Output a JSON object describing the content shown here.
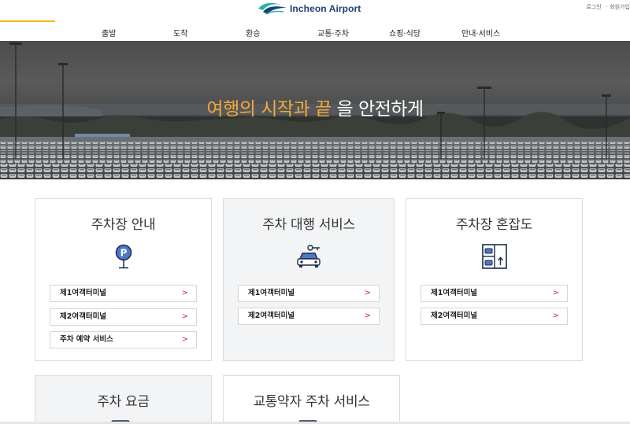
{
  "header": {
    "logo_text": "Incheon Airport",
    "util": {
      "login": "로그인",
      "join": "· 회원가입"
    },
    "nav": [
      {
        "label": "출발"
      },
      {
        "label": "도착"
      },
      {
        "label": "환승"
      },
      {
        "label": "교통·주차"
      },
      {
        "label": "쇼핑·식당"
      },
      {
        "label": "안내·서비스"
      }
    ]
  },
  "hero": {
    "title_highlight": "여행의 시작과 끝",
    "title_rest": " 을 안전하게"
  },
  "cards": {
    "parking_info": {
      "title": "주차장 안내",
      "links": [
        "제1여객터미널",
        "제2여객터미널",
        "주차 예약 서비스"
      ]
    },
    "valet": {
      "title": "주차 대행 서비스",
      "links": [
        "제1여객터미널",
        "제2여객터미널"
      ]
    },
    "congestion": {
      "title": "주차장 혼잡도",
      "links": [
        "제1여객터미널",
        "제2여객터미널"
      ]
    },
    "fee": {
      "title": "주차 요금"
    },
    "accessible": {
      "title": "교통약자 주차 서비스"
    }
  },
  "arrow_glyph": ">",
  "colors": {
    "accent_orange": "#f5a83a",
    "accent_yellow": "#f5b800",
    "arrow_red": "#d0282e",
    "brand_navy": "#1f3f78",
    "brand_teal": "#2bb3a8",
    "card_gray": "#f3f4f6"
  }
}
